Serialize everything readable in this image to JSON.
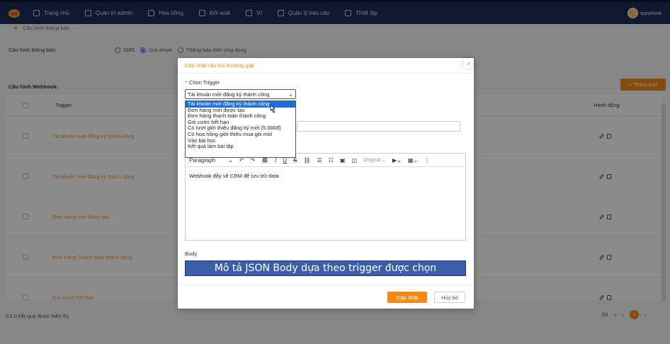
{
  "nav": {
    "items": [
      {
        "label": "Trang chủ",
        "icon": "home-icon"
      },
      {
        "label": "Quản trị admin",
        "icon": "admin-icon"
      },
      {
        "label": "Hoa hồng",
        "icon": "commission-icon"
      },
      {
        "label": "Đối soát",
        "icon": "reconcile-icon"
      },
      {
        "label": "Ví",
        "icon": "wallet-icon"
      },
      {
        "label": "Quản lý báo cáo",
        "icon": "report-icon"
      },
      {
        "label": "Thiết lập",
        "icon": "settings-icon"
      }
    ],
    "user": "sunshine"
  },
  "page": {
    "breadcrumb": "Cấu hình thông báo",
    "notif_label": "Cấu hình thông báo:",
    "notif_options": [
      "SMS",
      "Gửi email",
      "Thông báo trên ứng dụng"
    ],
    "webhook_title": "Cấu hình Webhook:",
    "add_button": "+ Thêm mới",
    "columns": {
      "trigger": "Trigger",
      "actions": "Hành động"
    },
    "rows": [
      "Tài khoản mới đăng ký thành công",
      "Tài khoản mới đăng ký thành công",
      "Đơn hàng mới được tạo",
      "Đơn hàng Thanh toán thành công",
      "Gói cước hết hạn"
    ],
    "footer_text": "Có 0 kết quả được hiển thị",
    "page_size": "50",
    "current_page": "1"
  },
  "modal": {
    "title": "Cập nhật câu hỏi thường gặp",
    "close": "×",
    "trigger_label": "Chọn Trigger",
    "trigger_value": "Tài khoản mới đăng ký thành công",
    "trigger_options": [
      "Tài khoản mới đăng ký thành công",
      "Đơn hàng mới được tạo",
      "Đơn hàng thanh toán thành công",
      "Gói cước hết hạn",
      "Có lượt giới thiệu đăng ký mới (5.000đ)",
      "Có hoa hồng giới thiệu mua gói mới",
      "Vào bài học",
      "Kết quả làm bài tập"
    ],
    "toolbar": {
      "paragraph": "Paragraph",
      "image_size": "Original"
    },
    "editor_text": "Webhook đẩy về CRM để lưu trữ data",
    "body_label": "Body",
    "banner": "Mô tả JSON Body dựa theo trigger được chọn",
    "update_button": "Cập nhật",
    "cancel_button": "Hủy bỏ"
  },
  "colors": {
    "accent": "#f28a1a",
    "nav_bg": "#1f2a5a",
    "banner": "#3c5ea8",
    "selected_option": "#1e6fd9"
  }
}
